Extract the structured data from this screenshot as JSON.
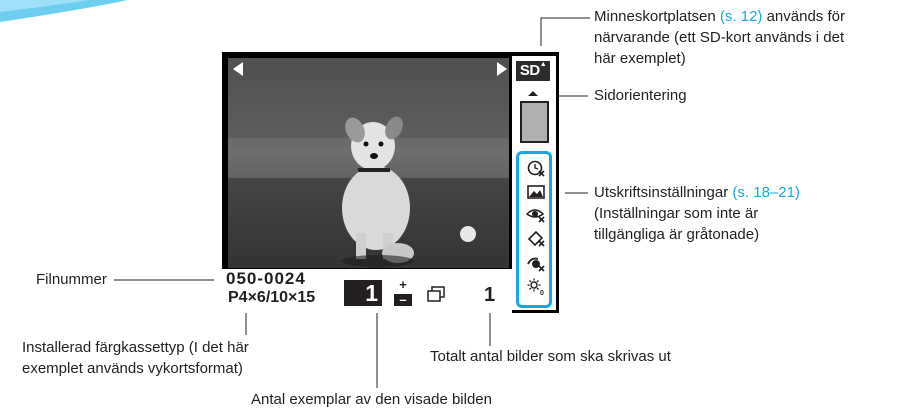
{
  "screen": {
    "sd_label": "SD",
    "file_number": "050-0024",
    "cartridge_type": "P4×6/10×15",
    "copies_value": "1",
    "copies_plus": "+",
    "copies_minus": "–",
    "total_prints": "1"
  },
  "settings_icons": [
    "date-icon",
    "image-optimize-icon",
    "red-eye-icon",
    "border-icon",
    "color-effect-icon",
    "brightness-icon"
  ],
  "annotations": {
    "memory_card": {
      "line1_prefix": "Minneskortplatsen ",
      "line1_link": "(s. 12)",
      "line1_suffix": " används för",
      "line2": "närvarande (ett SD-kort används i det",
      "line3": "här exemplet)"
    },
    "page_orientation": "Sidorientering",
    "print_settings": {
      "line1_prefix": "Utskriftsinställningar ",
      "line1_link": "(s. 18–21)",
      "line2": "(Inställningar som inte är",
      "line3": "tillgängliga är gråtonade)"
    },
    "file_number": "Filnummer",
    "cartridge": {
      "line1": "Installerad färgkassettyp (I det här",
      "line2": "exemplet används vykortsformat)"
    },
    "total": "Totalt antal bilder som ska skrivas ut",
    "copies": "Antal exemplar av den visade bilden"
  },
  "colors": {
    "accent": "#1aa7dd",
    "text": "#231f20"
  }
}
